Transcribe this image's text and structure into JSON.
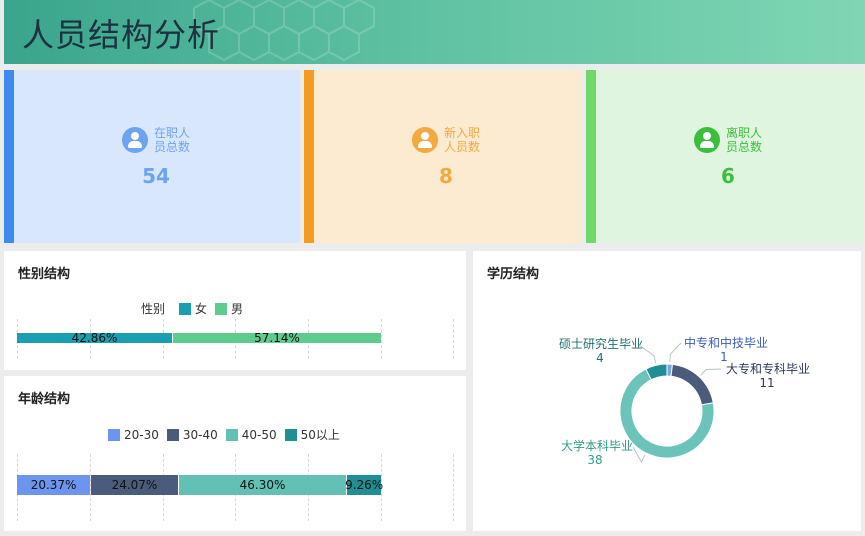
{
  "header": {
    "title": "人员结构分析"
  },
  "kpis": [
    {
      "label": "在职人员总数",
      "line1": "在职人",
      "line2": "员总数",
      "value": "54",
      "color": "#6ea3f2",
      "bar": "#3d8bf0",
      "bg": "#d8e7fb"
    },
    {
      "label": "新入职人员数",
      "line1": "新入职",
      "line2": "人员数",
      "value": "8",
      "color": "#f2a940",
      "bar": "#f39c1f",
      "bg": "#fdebd1"
    },
    {
      "label": "离职人员总数",
      "line1": "离职人",
      "line2": "员总数",
      "value": "6",
      "color": "#3bbf3b",
      "bar": "#6ed86a",
      "bg": "#dff5e0"
    }
  ],
  "gender": {
    "title": "性别结构",
    "legend_title": "性别",
    "chart_data": {
      "type": "bar",
      "stacked": true,
      "series": [
        {
          "name": "女",
          "value": 42.86,
          "label": "42.86%",
          "color": "#1a9fb0"
        },
        {
          "name": "男",
          "value": 57.14,
          "label": "57.14%",
          "color": "#5fcc8f"
        }
      ]
    }
  },
  "age": {
    "title": "年龄结构",
    "chart_data": {
      "type": "bar",
      "stacked": true,
      "series": [
        {
          "name": "20-30",
          "value": 20.37,
          "label": "20.37%",
          "color": "#6e95ee"
        },
        {
          "name": "30-40",
          "value": 24.07,
          "label": "24.07%",
          "color": "#4a5b7b"
        },
        {
          "name": "40-50",
          "value": 46.3,
          "label": "46.30%",
          "color": "#62c1b4"
        },
        {
          "name": "50以上",
          "value": 9.26,
          "label": "9.26%",
          "color": "#1f8f95"
        }
      ]
    }
  },
  "education": {
    "title": "学历结构",
    "chart_data": {
      "type": "pie",
      "donut": true,
      "slices": [
        {
          "name": "中专和中技毕业",
          "value": 1,
          "color": "#7ca2e8",
          "label_color": "#3b5db8"
        },
        {
          "name": "大专和专科毕业",
          "value": 11,
          "color": "#4a5b7b",
          "label_color": "#2d3a55"
        },
        {
          "name": "大学本科毕业",
          "value": 38,
          "color": "#6cc3b9",
          "label_color": "#2e9c8c"
        },
        {
          "name": "硕士研究生毕业",
          "value": 4,
          "color": "#1f8f95",
          "label_color": "#1f6f72"
        }
      ]
    }
  }
}
